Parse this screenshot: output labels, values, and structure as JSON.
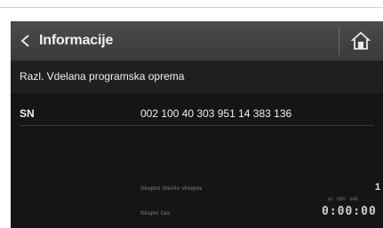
{
  "header": {
    "title": "Informacije",
    "back_icon": "chevron-left-icon",
    "home_icon": "home-icon"
  },
  "installed_software": {
    "label": "Razl. Vdelana programska oprema"
  },
  "serial": {
    "label": "SN",
    "value": "002 100 40 303 951 14 383 136"
  },
  "stats": {
    "count_label": "Skupno število vklopov",
    "count_value": "1",
    "time_label": "Skupni čas",
    "time_units": "ur min sek",
    "time_value": "0:00:00"
  },
  "colors": {
    "screen_bg": "#151515",
    "header_bg": "#404040",
    "text": "#f0f0f0",
    "top_rule": "#e9c9a4"
  }
}
